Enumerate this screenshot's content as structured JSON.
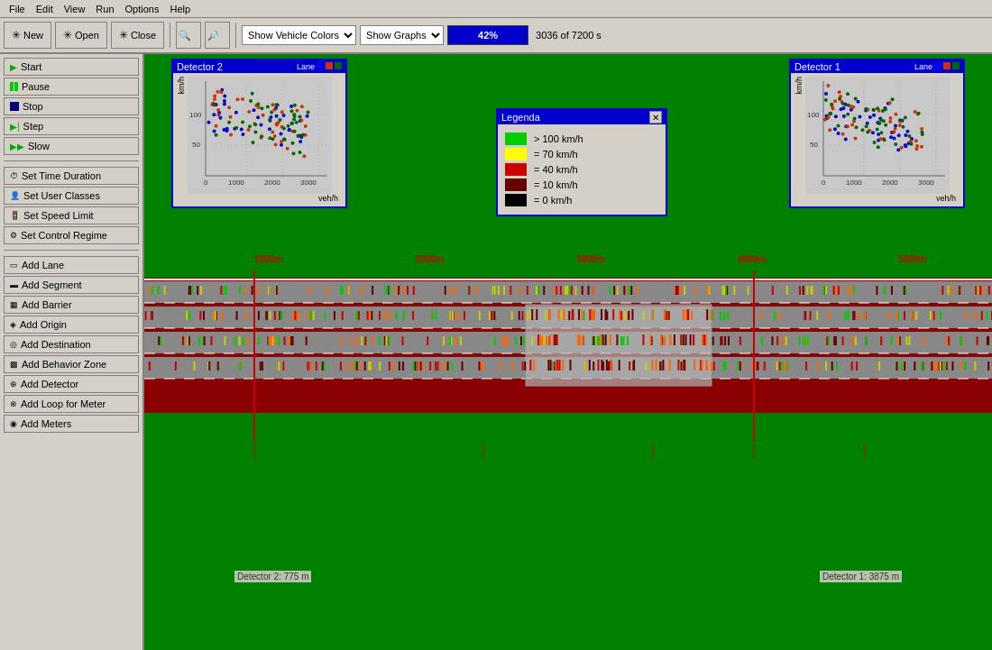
{
  "menubar": {
    "items": [
      "File",
      "Edit",
      "View",
      "Run",
      "Options",
      "Help"
    ]
  },
  "toolbar": {
    "new_label": "New",
    "open_label": "Open",
    "close_label": "Close",
    "zoom_in_label": "",
    "zoom_out_label": "",
    "show_vehicle_colors_label": "Show Vehicle Colors",
    "show_graphs_label": "Show Graphs",
    "progress_pct": "42%",
    "time_display": "3036 of 7200 s"
  },
  "left_panel": {
    "simulation_buttons": [
      {
        "id": "start",
        "label": "Start",
        "icon": "triangle"
      },
      {
        "id": "pause",
        "label": "Pause",
        "icon": "pause"
      },
      {
        "id": "stop",
        "label": "Stop",
        "icon": "stop"
      },
      {
        "id": "step",
        "label": "Step",
        "icon": "step"
      },
      {
        "id": "slow",
        "label": "Slow",
        "icon": "slow"
      }
    ],
    "config_buttons": [
      {
        "id": "time-duration",
        "label": "Set Time Duration"
      },
      {
        "id": "user-classes",
        "label": "Set User Classes"
      },
      {
        "id": "speed-limit",
        "label": "Set Speed Limit"
      },
      {
        "id": "control-regime",
        "label": "Set Control Regime"
      }
    ],
    "add_buttons": [
      {
        "id": "add-lane",
        "label": "Add Lane"
      },
      {
        "id": "add-segment",
        "label": "Add Segment"
      },
      {
        "id": "add-barrier",
        "label": "Add Barrier"
      },
      {
        "id": "add-origin",
        "label": "Add Origin"
      },
      {
        "id": "add-destination",
        "label": "Add Destination"
      },
      {
        "id": "add-behavior-zone",
        "label": "Add Behavior Zone"
      },
      {
        "id": "add-detector",
        "label": "Add Detector"
      },
      {
        "id": "add-loop-for-meter",
        "label": "Add Loop for Meter"
      },
      {
        "id": "add-meters",
        "label": "Add Meters"
      }
    ]
  },
  "detector1": {
    "title": "Detector 1",
    "x_label": "veh/h",
    "y_label": "km/h",
    "lane_label": "Lane",
    "y_ticks": [
      "100",
      "50"
    ],
    "x_ticks": [
      "0",
      "1000",
      "2000",
      "3000"
    ],
    "position_label": "Detector 1: 3875 m"
  },
  "detector2": {
    "title": "Detector 2",
    "x_label": "veh/h",
    "y_label": "km/h",
    "lane_label": "Lane",
    "y_ticks": [
      "100",
      "50"
    ],
    "x_ticks": [
      "0",
      "1000",
      "2000",
      "3000"
    ],
    "position_label": "Detector 2: 775 m"
  },
  "legend": {
    "title": "Legenda",
    "items": [
      {
        "color": "#00cc00",
        "label": "> 100 km/h"
      },
      {
        "color": "#ffff00",
        "label": "= 70 km/h"
      },
      {
        "color": "#cc0000",
        "label": "= 40 km/h"
      },
      {
        "color": "#660000",
        "label": "= 10 km/h"
      },
      {
        "color": "#000000",
        "label": "= 0 km/h"
      }
    ]
  },
  "distance_markers": [
    {
      "label": "1000m",
      "left_pct": 14
    },
    {
      "label": "2000m",
      "left_pct": 33
    },
    {
      "label": "3000m",
      "left_pct": 52
    },
    {
      "label": "4000m",
      "left_pct": 71
    },
    {
      "label": "5000m",
      "left_pct": 90
    }
  ],
  "colors": {
    "road_bg": "#8b0000",
    "lane_bg": "#888888",
    "grass": "#008000",
    "progress_bg": "#0000cc"
  }
}
